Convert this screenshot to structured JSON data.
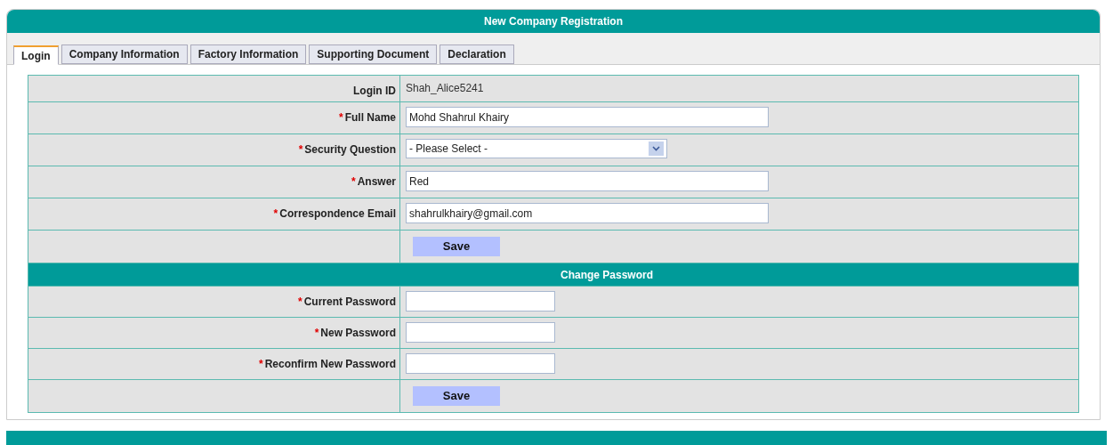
{
  "title": "New Company Registration",
  "tabs": [
    {
      "label": "Login",
      "selected": true
    },
    {
      "label": "Company Information",
      "selected": false
    },
    {
      "label": "Factory Information",
      "selected": false
    },
    {
      "label": "Supporting Document",
      "selected": false
    },
    {
      "label": "Declaration",
      "selected": false
    }
  ],
  "sections": [
    {
      "rows": [
        {
          "kind": "text",
          "label": "Login ID",
          "value": "Shah_Alice5241"
        },
        {
          "kind": "input",
          "required_mark": "*",
          "label": "Full Name",
          "value": "Mohd Shahrul Khairy"
        },
        {
          "kind": "select",
          "required_mark": "*",
          "label": "Security Question",
          "value": "- Please Select -"
        },
        {
          "kind": "input",
          "required_mark": "*",
          "label": "Answer",
          "value": "Red"
        },
        {
          "kind": "input",
          "required_mark": "*",
          "label": "Correspondence Email",
          "value": "shahrulkhairy@gmail.com"
        },
        {
          "kind": "button",
          "label": "Save"
        }
      ]
    },
    {
      "heading": "Change Password",
      "rows": [
        {
          "kind": "password",
          "required_mark": "*",
          "label": "Current Password"
        },
        {
          "kind": "password",
          "required_mark": "*",
          "label": "New Password"
        },
        {
          "kind": "password",
          "required_mark": "*",
          "label": "Reconfirm New Password"
        },
        {
          "kind": "button",
          "label": "Save"
        }
      ]
    }
  ]
}
